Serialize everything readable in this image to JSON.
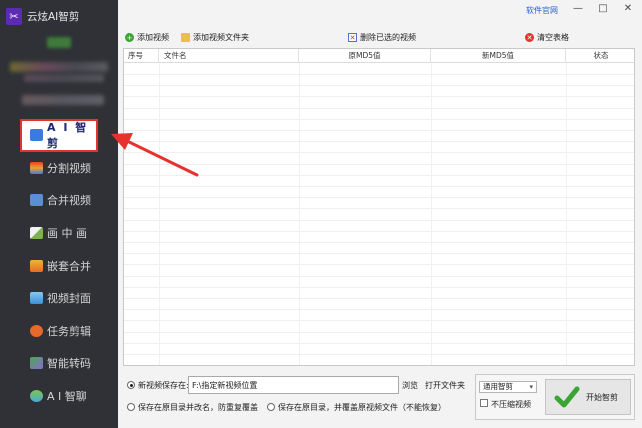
{
  "app": {
    "title": "云炫AI智剪"
  },
  "titlebar": {
    "website_link": "软件官网",
    "minimize": "—",
    "maximize": "□",
    "close": "✕"
  },
  "toolbar": {
    "add_video": "添加视频",
    "add_video_folder": "添加视频文件夹",
    "delete_selected": "删除已选的视频",
    "clear_table": "清空表格"
  },
  "table": {
    "columns": [
      "序号",
      "文件名",
      "原MD5值",
      "新MD5值",
      "状态"
    ]
  },
  "sidebar": {
    "items": [
      {
        "label": "A I 智剪",
        "icon": "scissors-icon",
        "color": "#3b7be0",
        "active": true
      },
      {
        "label": "分割视频",
        "icon": "split-icon",
        "color": "#f0a030"
      },
      {
        "label": "合并视频",
        "icon": "merge-icon",
        "color": "#5a8fd8"
      },
      {
        "label": "画 中 画",
        "icon": "picture-in-picture-icon",
        "color": "#7fb24f"
      },
      {
        "label": "嵌套合并",
        "icon": "nested-merge-icon",
        "color": "#e8b830"
      },
      {
        "label": "视频封面",
        "icon": "cover-image-icon",
        "color": "#3b8fd8"
      },
      {
        "label": "任务剪辑",
        "icon": "task-icon",
        "color": "#e86a2a"
      },
      {
        "label": "智能转码",
        "icon": "transcode-icon",
        "color": "#8a6ad8"
      },
      {
        "label": "A I 智聊",
        "icon": "chat-icon",
        "color": "#4aa8d8"
      }
    ]
  },
  "output": {
    "new_save_label": "新视频保存在:",
    "path_value": "F:\\指定新视频位置",
    "browse": "浏览",
    "open_folder": "打开文件夹",
    "save_original_rename": "保存在原目录并改名，防重复覆盖",
    "save_original_overwrite": "保存在原目录，并覆盖原视频文件（不能恢复）"
  },
  "options": {
    "mode_selected": "通用智剪",
    "no_compress_label": "不压缩视频",
    "start_label": "开始智剪"
  },
  "colors": {
    "sidebar_bg": "#2f3136",
    "accent_red": "#e5322d",
    "link_blue": "#2a5bd7",
    "check_green": "#3aa535"
  }
}
